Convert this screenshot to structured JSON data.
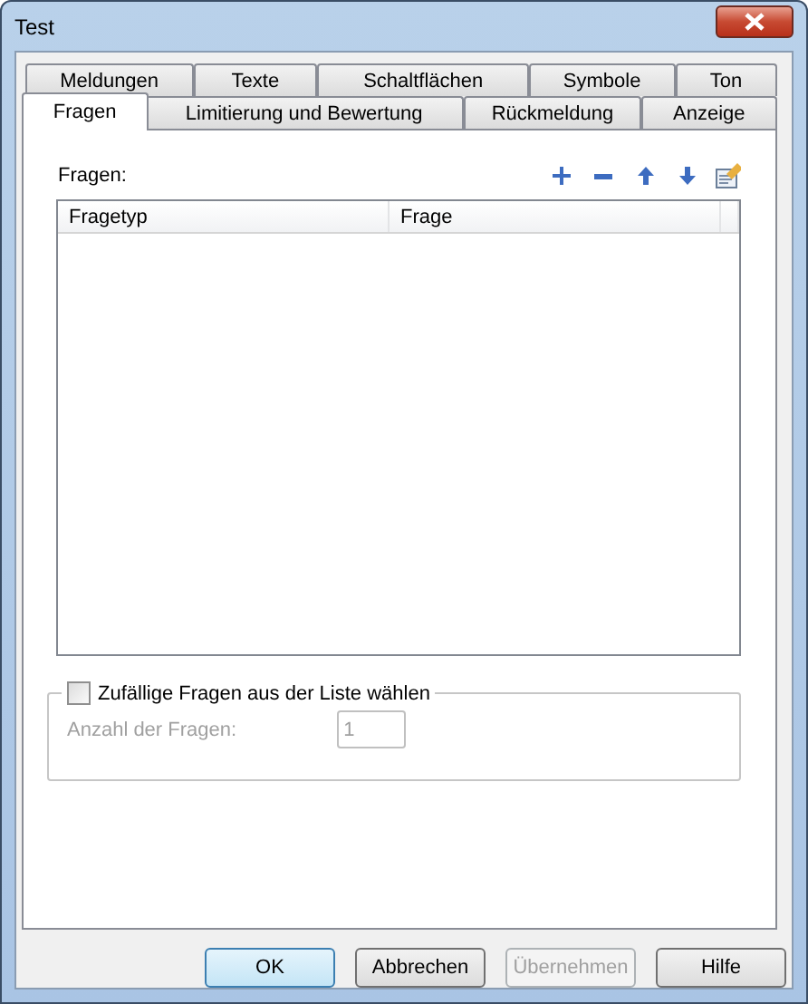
{
  "window": {
    "title": "Test"
  },
  "tab_rows": [
    [
      {
        "label": "Meldungen",
        "selected": false
      },
      {
        "label": "Texte",
        "selected": false
      },
      {
        "label": "Schaltflächen",
        "selected": false
      },
      {
        "label": "Symbole",
        "selected": false
      },
      {
        "label": "Ton",
        "selected": false
      }
    ],
    [
      {
        "label": "Fragen",
        "selected": true
      },
      {
        "label": "Limitierung und Bewertung",
        "selected": false
      },
      {
        "label": "Rückmeldung",
        "selected": false
      },
      {
        "label": "Anzeige",
        "selected": false
      }
    ]
  ],
  "questions": {
    "label": "Fragen:",
    "toolbar": [
      {
        "kind": "add"
      },
      {
        "kind": "remove"
      },
      {
        "kind": "up"
      },
      {
        "kind": "down"
      },
      {
        "kind": "edit"
      }
    ],
    "columns": [
      "Fragetyp",
      "Frage"
    ]
  },
  "random": {
    "checkbox": {
      "label": "Zufällige Fragen aus der Liste wählen",
      "checked": false
    },
    "count_label": "Anzahl der Fragen:",
    "count_value": "1",
    "disabled": true
  },
  "buttons": [
    {
      "label": "OK",
      "default": true,
      "disabled": false
    },
    {
      "label": "Abbrechen",
      "default": false,
      "disabled": false
    },
    {
      "label": "Übernehmen",
      "default": false,
      "disabled": true
    },
    {
      "label": "Hilfe",
      "default": false,
      "disabled": false
    }
  ]
}
